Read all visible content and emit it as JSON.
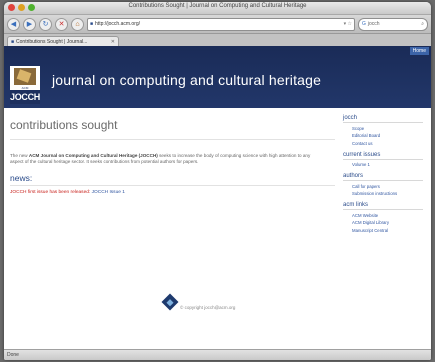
{
  "window": {
    "title": "Contributions Sought | Journal on Computing and Cultural Heritage"
  },
  "toolbar": {
    "url": "http://jocch.acm.org/",
    "search_value": "jocch"
  },
  "tab": {
    "label": "Contributions Sought | Journal..."
  },
  "header": {
    "home_label": "Home",
    "site_title": "journal on computing and cultural heritage",
    "logo_text": "JOCCH",
    "logo_small": "ACM"
  },
  "main": {
    "page_title": "contributions sought",
    "intro_pre": "The new ",
    "intro_bold": "ACM Journal on Computing and Cultural Heritage (JOCCH)",
    "intro_post": " seeks to increase the body of computing science with high attention to any aspect of the cultural heritage sector. It seeks contributions from potential authors for papers.",
    "news_heading": "news:",
    "news_red": "JOCCH first issue has been released: ",
    "news_link": "JOCCH Issue 1"
  },
  "sidebar": {
    "sections": [
      {
        "heading": "jocch",
        "items": [
          "Scope",
          "Editorial Board",
          "Contact us"
        ]
      },
      {
        "heading": "current issues",
        "items": [
          "Volume 1"
        ]
      },
      {
        "heading": "authors",
        "items": [
          "Call for papers",
          "Submission instructions"
        ]
      },
      {
        "heading": "acm links",
        "items": [
          "ACM Website",
          "ACM Digital Library",
          "Manuscript Central"
        ]
      }
    ]
  },
  "footer": {
    "copyright": "© copyright jocch@acm.org"
  },
  "statusbar": {
    "text": "Done"
  },
  "colors": {
    "header": "#1d2f5e",
    "link": "#2f55a0",
    "news_red": "#c8201b"
  }
}
